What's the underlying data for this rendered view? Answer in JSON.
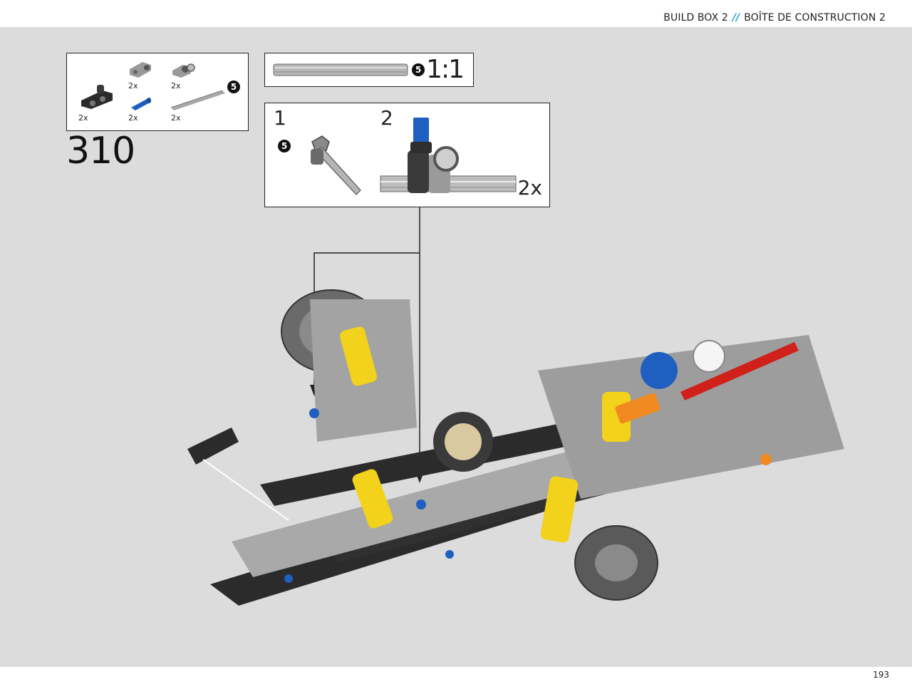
{
  "header": {
    "build_box_en": "BUILD BOX 2",
    "separator": "//",
    "build_box_fr": "BOÎTE DE CONSTRUCTION 2"
  },
  "step": {
    "number": "310"
  },
  "parts_list": {
    "items": [
      {
        "icon": "black-beam-connector-icon",
        "qty": "2x"
      },
      {
        "icon": "gray-pin-connector-icon",
        "qty": "2x"
      },
      {
        "icon": "blue-pin-icon",
        "qty": "2x"
      },
      {
        "icon": "gray-angle-connector-icon",
        "qty": "2x"
      },
      {
        "icon": "gray-axle-icon",
        "qty": "2x",
        "badge": "5"
      }
    ]
  },
  "ruler": {
    "badge": "5",
    "scale": "1:1"
  },
  "sub_assembly": {
    "step1": "1",
    "step1_badge": "5",
    "step2": "2",
    "qty": "2x"
  },
  "footer": {
    "page_number": "193"
  },
  "colors": {
    "background": "#dcdcdc",
    "accent": "#1aa0e0",
    "beam_black": "#2b2b2b",
    "beam_gray": "#b5b5b5",
    "yellow": "#f2d21a",
    "red": "#d0201a",
    "blue": "#1f5fc0",
    "orange": "#f08a20"
  }
}
